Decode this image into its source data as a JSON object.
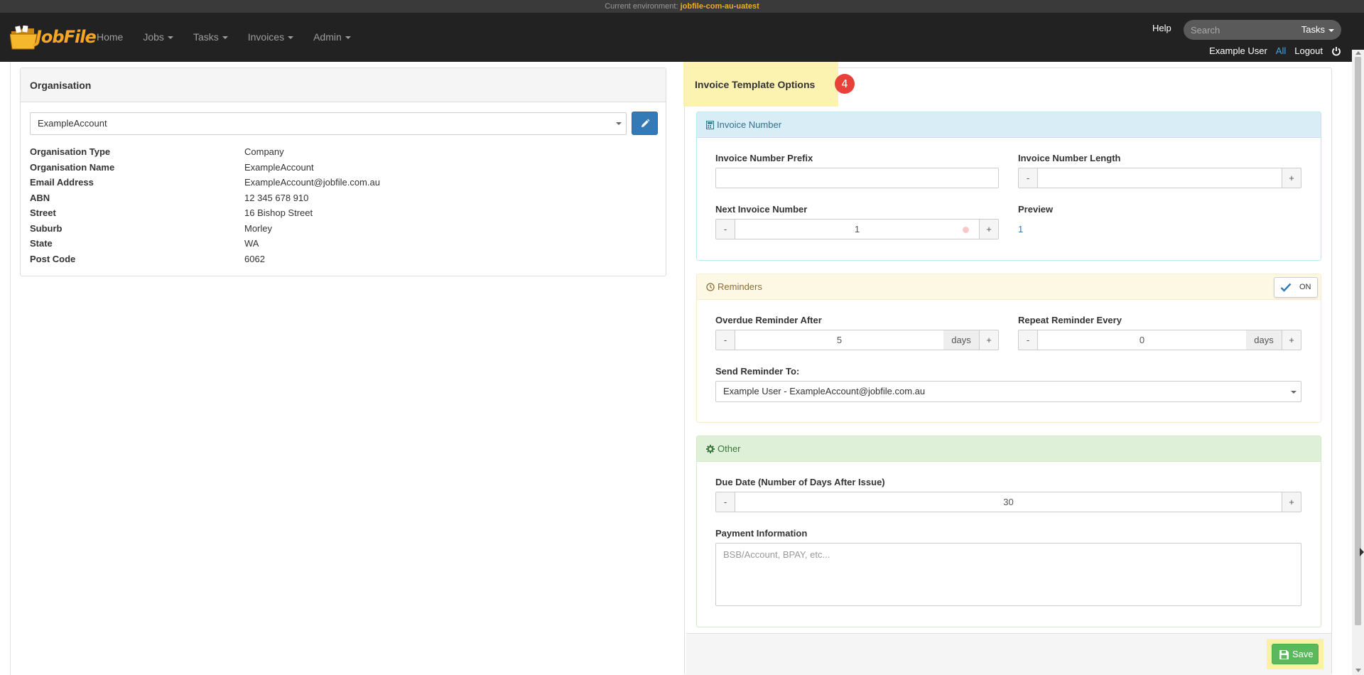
{
  "environment": {
    "prefix": "Current environment:",
    "name": "jobfile-com-au-uatest"
  },
  "brand": {
    "name": "JobFile",
    "color": "#f5a623"
  },
  "nav": {
    "items": [
      {
        "label": "Home",
        "dropdown": false
      },
      {
        "label": "Jobs",
        "dropdown": true
      },
      {
        "label": "Tasks",
        "dropdown": true
      },
      {
        "label": "Invoices",
        "dropdown": true
      },
      {
        "label": "Admin",
        "dropdown": true
      }
    ],
    "help": "Help",
    "search_placeholder": "Search",
    "search_scope": "Tasks",
    "user": "Example User",
    "all": "All",
    "logout": "Logout"
  },
  "organisation": {
    "title": "Organisation",
    "selected": "ExampleAccount",
    "fields": [
      {
        "label": "Organisation Type",
        "value": "Company"
      },
      {
        "label": "Organisation Name",
        "value": "ExampleAccount"
      },
      {
        "label": "Email Address",
        "value": "ExampleAccount@jobfile.com.au"
      },
      {
        "label": "ABN",
        "value": "12 345 678 910"
      },
      {
        "label": "Street",
        "value": "16 Bishop Street"
      },
      {
        "label": "Suburb",
        "value": "Morley"
      },
      {
        "label": "State",
        "value": "WA"
      },
      {
        "label": "Post Code",
        "value": "6062"
      }
    ]
  },
  "template": {
    "title": "Invoice Template Options",
    "step": "4",
    "invoice_number": {
      "heading": "Invoice Number",
      "prefix_label": "Invoice Number Prefix",
      "prefix_value": "",
      "length_label": "Invoice Number Length",
      "length_value": "",
      "next_label": "Next Invoice Number",
      "next_value": "1",
      "preview_label": "Preview",
      "preview_value": "1"
    },
    "reminders": {
      "heading": "Reminders",
      "toggle": "ON",
      "overdue_label": "Overdue Reminder After",
      "overdue_value": "5",
      "overdue_unit": "days",
      "repeat_label": "Repeat Reminder Every",
      "repeat_value": "0",
      "repeat_unit": "days",
      "send_label": "Send Reminder To:",
      "send_value": "Example User - ExampleAccount@jobfile.com.au"
    },
    "other": {
      "heading": "Other",
      "due_label": "Due Date (Number of Days After Issue)",
      "due_value": "30",
      "payment_label": "Payment Information",
      "payment_placeholder": "BSB/Account, BPAY, etc..."
    },
    "save": "Save",
    "minus": "-",
    "plus": "+"
  },
  "colors": {
    "highlight": "#fbf1a3",
    "badge": "#e8413a",
    "save": "#5cb85c",
    "primary": "#337ab7"
  }
}
